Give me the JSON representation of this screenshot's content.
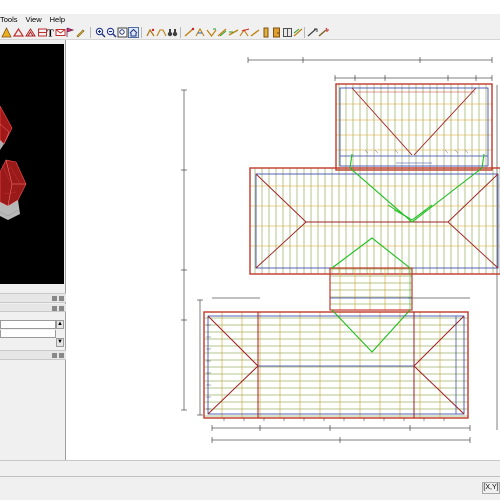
{
  "menubar": {
    "items": [
      "Tools",
      "View",
      "Help"
    ]
  },
  "toolbar": {
    "buttons": [
      "triangle-icon",
      "roof-plane-icon",
      "truss-icon",
      "text-icon",
      "envelope-icon",
      "flag-icon",
      "pencil-icon",
      "zoom-in-icon",
      "zoom-out-icon",
      "zoom-fit-icon",
      "house-view-icon",
      "walk-icon",
      "binoculars-icon",
      "trim-icon",
      "rafter-icon",
      "hip-icon",
      "valley-icon",
      "jack-icon",
      "ridge-icon",
      "gable-icon",
      "beam-icon",
      "frame-icon",
      "measure-icon",
      "wand-icon"
    ]
  },
  "colors": {
    "roof_outline": "#c0392b",
    "hip_valley": "#1fbf1f",
    "rafter": "#6a8a1a",
    "fascia": "#2c3ca8",
    "batten": "#d9a020",
    "dimension": "#000000",
    "viewport_bg": "#000000"
  },
  "drawing": {
    "sections": [
      "top-gable-wing",
      "main-body",
      "link-section",
      "bottom-wing"
    ]
  },
  "status": {
    "coords": "[X,Y]"
  }
}
